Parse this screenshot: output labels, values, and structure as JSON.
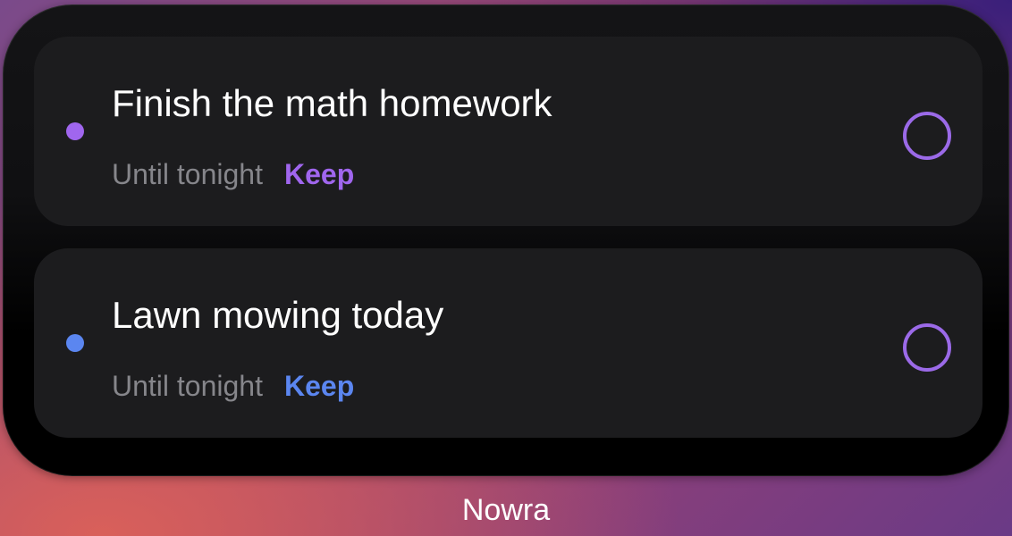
{
  "widget": {
    "name": "Nowra",
    "tasks": [
      {
        "title": "Finish the math homework",
        "due": "Until tonight",
        "action": "Keep",
        "color": "#a066ee"
      },
      {
        "title": "Lawn mowing today",
        "due": "Until tonight",
        "action": "Keep",
        "color": "#5b86f0"
      }
    ]
  },
  "colors": {
    "check_ring": "#9b6ae8",
    "card_bg": "#1c1c1e",
    "muted_text": "#86868b"
  }
}
